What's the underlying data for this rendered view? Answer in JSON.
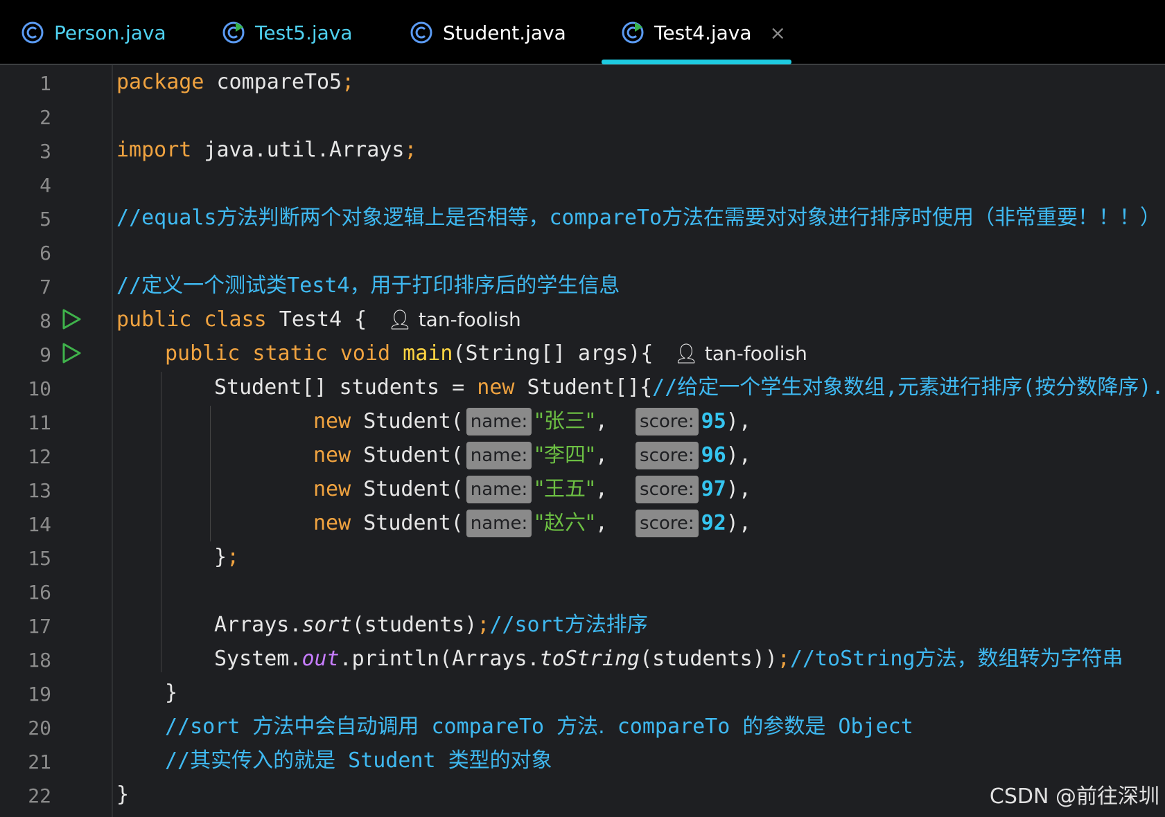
{
  "tabs": [
    {
      "label": "Person.java",
      "icon": "class-icon",
      "color": "#4fd1f0"
    },
    {
      "label": "Test5.java",
      "icon": "runnable-class-icon",
      "color": "#4fd1f0"
    },
    {
      "label": "Student.java",
      "icon": "class-icon",
      "color": "#ffffff"
    },
    {
      "label": "Test4.java",
      "icon": "runnable-class-icon",
      "color": "#ffffff",
      "active": true,
      "close": "×"
    }
  ],
  "line_numbers": [
    "1",
    "2",
    "3",
    "4",
    "5",
    "6",
    "7",
    "8",
    "9",
    "10",
    "11",
    "12",
    "13",
    "14",
    "15",
    "16",
    "17",
    "18",
    "19",
    "20",
    "21",
    "22"
  ],
  "code": {
    "l1": {
      "kw": "package",
      "rest": " compareTo5",
      "semi": ";"
    },
    "l3": {
      "kw": "import",
      "rest": " java.util.Arrays",
      "semi": ";"
    },
    "l5": {
      "a": "//equals",
      "b": "方法判断两个对象逻辑上是否相等，",
      "c": "compareTo",
      "d": "方法在需要对对象进行排序时使用（非常重要！！！）"
    },
    "l7": {
      "a": "//",
      "b": "定义一个测试类",
      "c": "Test4",
      "d": "，用于打印排序后的学生信息"
    },
    "l8": {
      "kw": "public class",
      "rest": " Test4 {",
      "author": "tan-foolish"
    },
    "l9": {
      "kw": "public static void",
      "fn": "main",
      "rest": "(String[] args){",
      "author": "tan-foolish"
    },
    "l10": {
      "a": "Student[] students = ",
      "kw": "new",
      "b": " Student[]{",
      "c": "//",
      "d": "给定一个学生对象数组",
      "e": ",",
      "f": "元素进行排序",
      "g": "(",
      "h": "按分数降序",
      "i": ")."
    },
    "rows": [
      {
        "name": "\"张三\"",
        "score": "95"
      },
      {
        "name": "\"李四\"",
        "score": "96"
      },
      {
        "name": "\"王五\"",
        "score": "97"
      },
      {
        "name": "\"赵六\"",
        "score": "92"
      }
    ],
    "new_kw": "new",
    "student_ctor": " Student(",
    "name_hint": "name:",
    "score_hint": "score:",
    "comma": ",",
    "close_paren": "),",
    "l15": {
      "brace": "}",
      "semi": ";"
    },
    "l17": {
      "a": "Arrays.",
      "b": "sort",
      "c": "(students)",
      "d": ";",
      "e": "//sort",
      "f": "方法排序"
    },
    "l18": {
      "a": "System.",
      "b": "out",
      "c": ".println(Arrays.",
      "d": "toString",
      "e": "(students))",
      "f": ";",
      "g": "//toString",
      "h": "方法，数组转为字符串"
    },
    "l19": "}",
    "l20": {
      "a": "//sort ",
      "b": "方法中会自动调用",
      "c": " compareTo ",
      "d": "方法.",
      "e": " compareTo ",
      "f": "的参数是",
      "g": " Object"
    },
    "l21": {
      "a": "//",
      "b": "其实传入的就是",
      "c": " Student ",
      "d": "类型的对象"
    },
    "l22": "}"
  },
  "watermark": "CSDN @前往深圳",
  "colors": {
    "keyword": "#f0a340",
    "comment": "#3fb9f1",
    "string": "#6cbf43",
    "number": "#35c5f0",
    "function": "#ffd542",
    "accent": "#1ecbe1"
  }
}
